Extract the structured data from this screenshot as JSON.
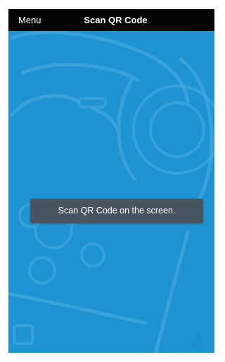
{
  "topbar": {
    "menu_label": "Menu",
    "title": "Scan QR Code"
  },
  "toast": {
    "message": "Scan QR Code on the screen."
  },
  "colors": {
    "camera_background": "#1f93d2",
    "topbar_background": "#050505",
    "toast_background": "#4a5460"
  },
  "icons": {
    "logo": "app-logo-icon"
  }
}
